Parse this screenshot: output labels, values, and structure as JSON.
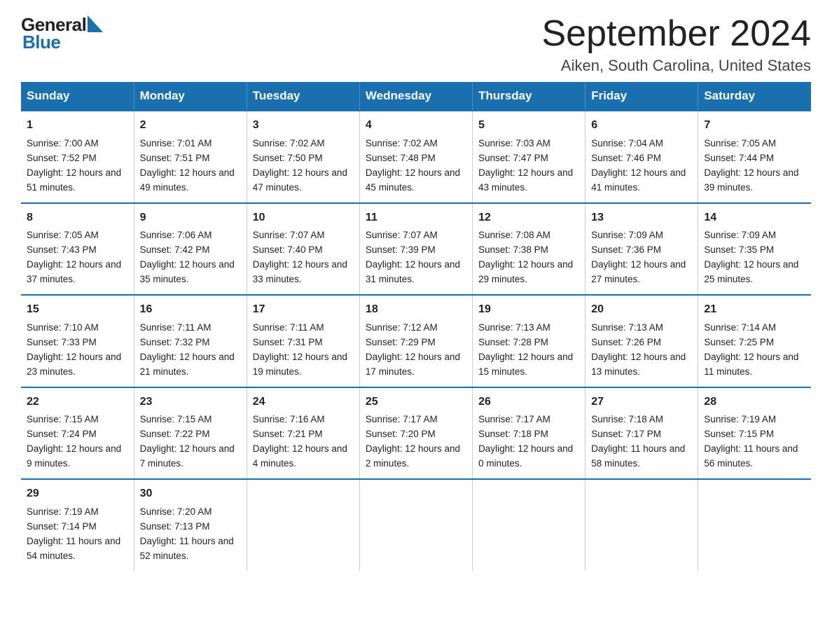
{
  "header": {
    "logo_general": "General",
    "logo_blue": "Blue",
    "month_title": "September 2024",
    "location": "Aiken, South Carolina, United States"
  },
  "calendar": {
    "days_of_week": [
      "Sunday",
      "Monday",
      "Tuesday",
      "Wednesday",
      "Thursday",
      "Friday",
      "Saturday"
    ],
    "weeks": [
      [
        {
          "day": "1",
          "sunrise": "7:00 AM",
          "sunset": "7:52 PM",
          "daylight": "12 hours and 51 minutes."
        },
        {
          "day": "2",
          "sunrise": "7:01 AM",
          "sunset": "7:51 PM",
          "daylight": "12 hours and 49 minutes."
        },
        {
          "day": "3",
          "sunrise": "7:02 AM",
          "sunset": "7:50 PM",
          "daylight": "12 hours and 47 minutes."
        },
        {
          "day": "4",
          "sunrise": "7:02 AM",
          "sunset": "7:48 PM",
          "daylight": "12 hours and 45 minutes."
        },
        {
          "day": "5",
          "sunrise": "7:03 AM",
          "sunset": "7:47 PM",
          "daylight": "12 hours and 43 minutes."
        },
        {
          "day": "6",
          "sunrise": "7:04 AM",
          "sunset": "7:46 PM",
          "daylight": "12 hours and 41 minutes."
        },
        {
          "day": "7",
          "sunrise": "7:05 AM",
          "sunset": "7:44 PM",
          "daylight": "12 hours and 39 minutes."
        }
      ],
      [
        {
          "day": "8",
          "sunrise": "7:05 AM",
          "sunset": "7:43 PM",
          "daylight": "12 hours and 37 minutes."
        },
        {
          "day": "9",
          "sunrise": "7:06 AM",
          "sunset": "7:42 PM",
          "daylight": "12 hours and 35 minutes."
        },
        {
          "day": "10",
          "sunrise": "7:07 AM",
          "sunset": "7:40 PM",
          "daylight": "12 hours and 33 minutes."
        },
        {
          "day": "11",
          "sunrise": "7:07 AM",
          "sunset": "7:39 PM",
          "daylight": "12 hours and 31 minutes."
        },
        {
          "day": "12",
          "sunrise": "7:08 AM",
          "sunset": "7:38 PM",
          "daylight": "12 hours and 29 minutes."
        },
        {
          "day": "13",
          "sunrise": "7:09 AM",
          "sunset": "7:36 PM",
          "daylight": "12 hours and 27 minutes."
        },
        {
          "day": "14",
          "sunrise": "7:09 AM",
          "sunset": "7:35 PM",
          "daylight": "12 hours and 25 minutes."
        }
      ],
      [
        {
          "day": "15",
          "sunrise": "7:10 AM",
          "sunset": "7:33 PM",
          "daylight": "12 hours and 23 minutes."
        },
        {
          "day": "16",
          "sunrise": "7:11 AM",
          "sunset": "7:32 PM",
          "daylight": "12 hours and 21 minutes."
        },
        {
          "day": "17",
          "sunrise": "7:11 AM",
          "sunset": "7:31 PM",
          "daylight": "12 hours and 19 minutes."
        },
        {
          "day": "18",
          "sunrise": "7:12 AM",
          "sunset": "7:29 PM",
          "daylight": "12 hours and 17 minutes."
        },
        {
          "day": "19",
          "sunrise": "7:13 AM",
          "sunset": "7:28 PM",
          "daylight": "12 hours and 15 minutes."
        },
        {
          "day": "20",
          "sunrise": "7:13 AM",
          "sunset": "7:26 PM",
          "daylight": "12 hours and 13 minutes."
        },
        {
          "day": "21",
          "sunrise": "7:14 AM",
          "sunset": "7:25 PM",
          "daylight": "12 hours and 11 minutes."
        }
      ],
      [
        {
          "day": "22",
          "sunrise": "7:15 AM",
          "sunset": "7:24 PM",
          "daylight": "12 hours and 9 minutes."
        },
        {
          "day": "23",
          "sunrise": "7:15 AM",
          "sunset": "7:22 PM",
          "daylight": "12 hours and 7 minutes."
        },
        {
          "day": "24",
          "sunrise": "7:16 AM",
          "sunset": "7:21 PM",
          "daylight": "12 hours and 4 minutes."
        },
        {
          "day": "25",
          "sunrise": "7:17 AM",
          "sunset": "7:20 PM",
          "daylight": "12 hours and 2 minutes."
        },
        {
          "day": "26",
          "sunrise": "7:17 AM",
          "sunset": "7:18 PM",
          "daylight": "12 hours and 0 minutes."
        },
        {
          "day": "27",
          "sunrise": "7:18 AM",
          "sunset": "7:17 PM",
          "daylight": "11 hours and 58 minutes."
        },
        {
          "day": "28",
          "sunrise": "7:19 AM",
          "sunset": "7:15 PM",
          "daylight": "11 hours and 56 minutes."
        }
      ],
      [
        {
          "day": "29",
          "sunrise": "7:19 AM",
          "sunset": "7:14 PM",
          "daylight": "11 hours and 54 minutes."
        },
        {
          "day": "30",
          "sunrise": "7:20 AM",
          "sunset": "7:13 PM",
          "daylight": "11 hours and 52 minutes."
        },
        null,
        null,
        null,
        null,
        null
      ]
    ]
  }
}
